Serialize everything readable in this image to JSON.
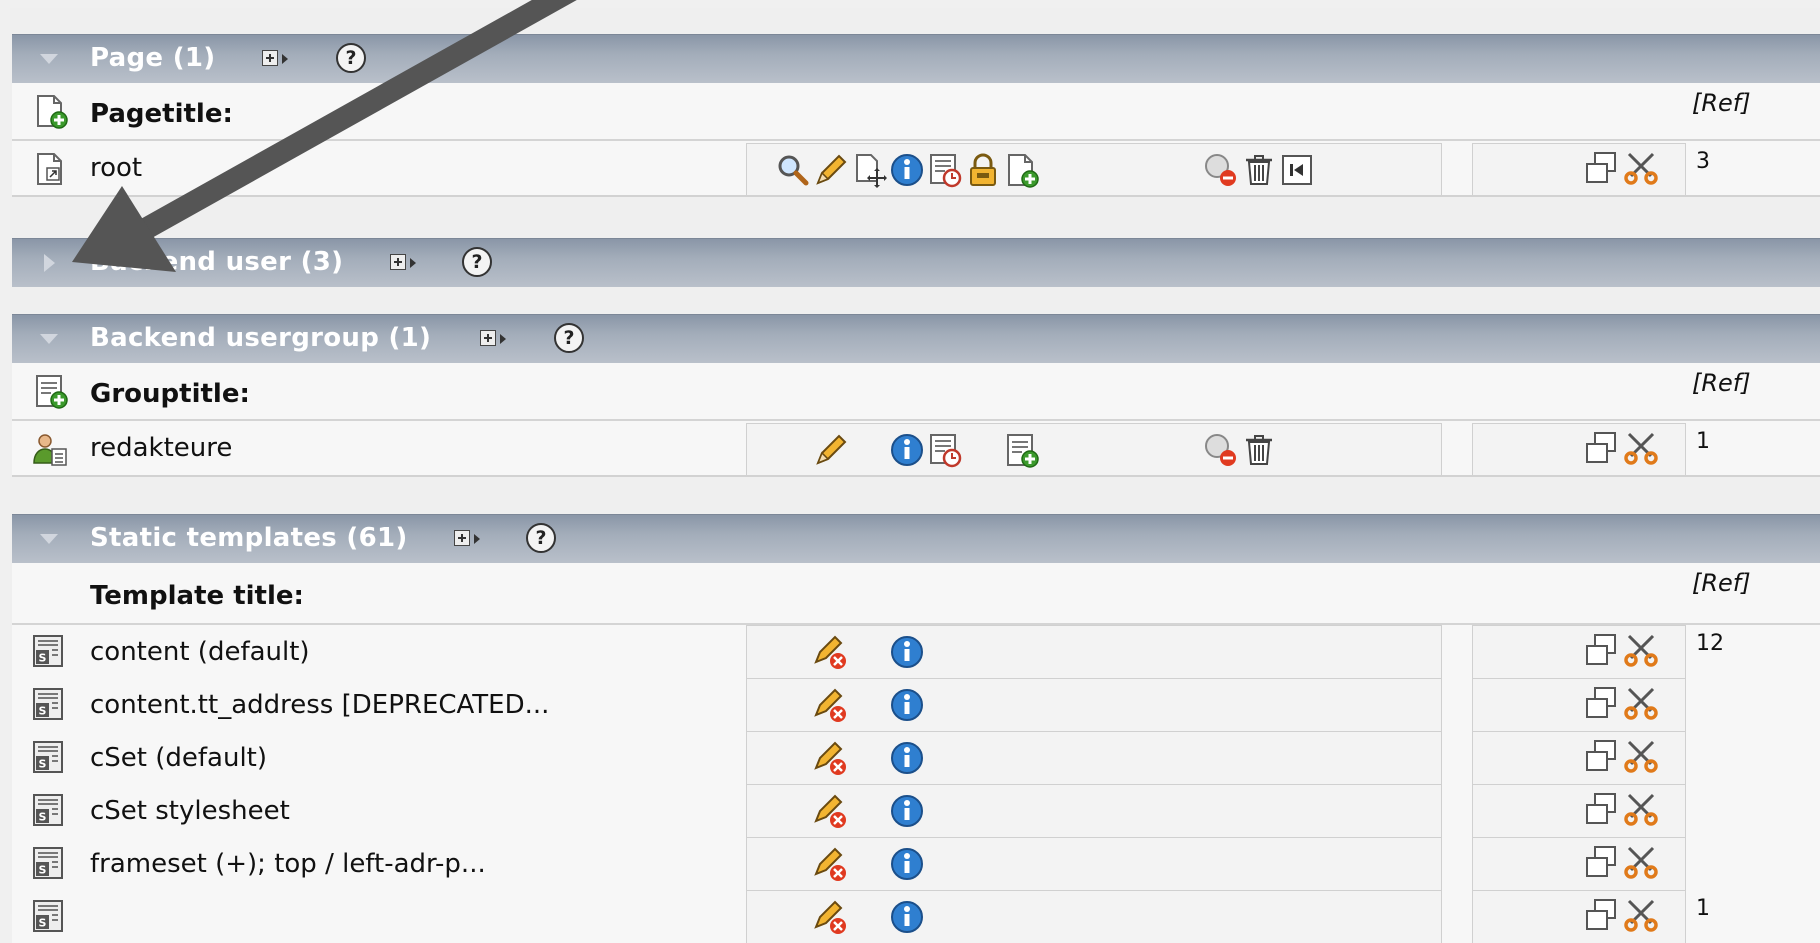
{
  "sections": {
    "page": {
      "title": "Page (1)",
      "col_label": "Pagetitle:",
      "ref_label": "[Ref]",
      "rows": [
        {
          "title": "root",
          "ref": "3"
        }
      ]
    },
    "be_user": {
      "title": "Backend user (3)"
    },
    "be_group": {
      "title": "Backend usergroup (1)",
      "col_label": "Grouptitle:",
      "ref_label": "[Ref]",
      "rows": [
        {
          "title": "redakteure",
          "ref": "1"
        }
      ]
    },
    "static": {
      "title": "Static templates (61)",
      "col_label": "Template title:",
      "ref_label": "[Ref]",
      "rows": [
        {
          "title": "content (default)",
          "ref": "12"
        },
        {
          "title": "content.tt_address [DEPRECATED...",
          "ref": ""
        },
        {
          "title": "cSet (default)",
          "ref": ""
        },
        {
          "title": "cSet stylesheet",
          "ref": ""
        },
        {
          "title": "frameset (+); top / left-adr-p...",
          "ref": ""
        },
        {
          "title": "",
          "ref": "1"
        }
      ]
    }
  },
  "help_glyph": "?",
  "colors": {
    "header_top": "#8a96a7",
    "header_bottom": "#b9c0ca",
    "arrow": "#555555",
    "info_blue": "#2f7fd0",
    "scissors_orange": "#e07a1a"
  }
}
